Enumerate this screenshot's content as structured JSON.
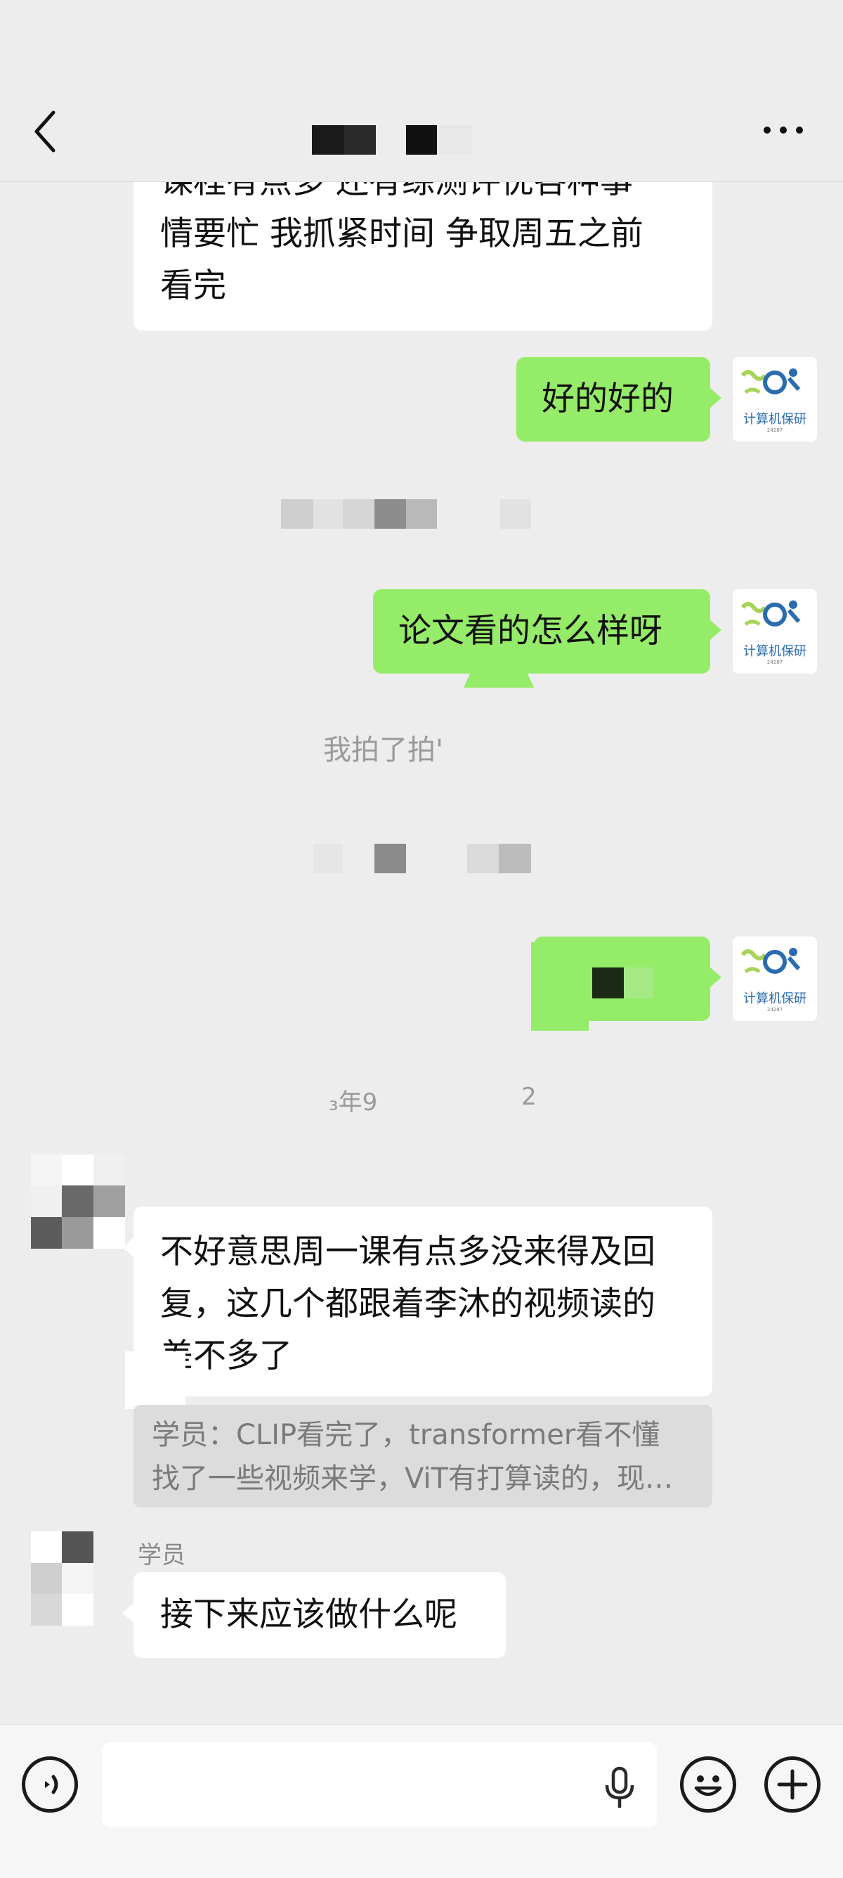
{
  "header": {
    "back_icon": "chevron-left-icon",
    "more_icon": "more-dots-icon"
  },
  "messages": {
    "m1_lines": [
      "课程有点多 还有综测评优各种事",
      "情要忙 我抓紧时间 争取周五之前",
      "看完"
    ],
    "m2_text": "好的好的",
    "m3_text": "论文看的怎么样呀",
    "m4_text": "我拍了拍'",
    "m5_time": "₃年9",
    "m5_time_right": "2",
    "m6_lines": [
      "不好意思周一课有点多没来得及回",
      "复，这几个都跟着李沐的视频读的",
      "差不多了"
    ],
    "m6_quote_lines": [
      "学员：CLIP看完了，transformer看不懂",
      "找了一些视频来学，ViT有打算读的，现…"
    ],
    "m7_sender": "学员",
    "m7_text": "接下来应该做什么呢"
  },
  "avatar": {
    "logo_text": "计算机保研",
    "logo_sub": "24287"
  },
  "input_bar": {
    "placeholder": "",
    "voice_icon": "voice-icon",
    "mic_icon": "microphone-icon",
    "emoji_icon": "emoji-icon",
    "plus_icon": "plus-icon"
  },
  "colors": {
    "background": "#ededed",
    "green_bubble": "#95ec69",
    "white_bubble": "#ffffff"
  }
}
